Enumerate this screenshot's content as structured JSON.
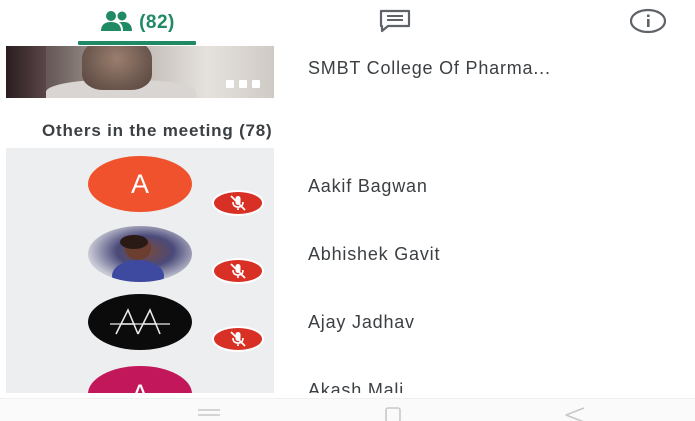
{
  "tabs": {
    "people": {
      "icon": "people-icon",
      "count": "(82)"
    },
    "chat": {
      "icon": "chat-icon"
    },
    "info": {
      "icon": "info-icon"
    },
    "accent_color": "#1f8a63"
  },
  "presenter": {
    "name": "SMBT College Of Pharma..."
  },
  "others": {
    "title": "Others in the meeting (78)",
    "participants": [
      {
        "name": "Aakif Bagwan",
        "avatar_letter": "A",
        "avatar_color": "#f0522d",
        "muted": true
      },
      {
        "name": "Abhishek Gavit",
        "avatar_letter": "",
        "avatar_color": "photo",
        "muted": true
      },
      {
        "name": "Ajay Jadhav",
        "avatar_letter": "",
        "avatar_color": "#0b0b0b",
        "muted": true
      },
      {
        "name": "Akash Mali",
        "avatar_letter": "A",
        "avatar_color": "#c2185b",
        "muted": false
      }
    ]
  },
  "navbar": {
    "menu_icon": "menu-icon",
    "home_icon": "home-square-icon",
    "back_icon": "back-triangle-icon"
  }
}
